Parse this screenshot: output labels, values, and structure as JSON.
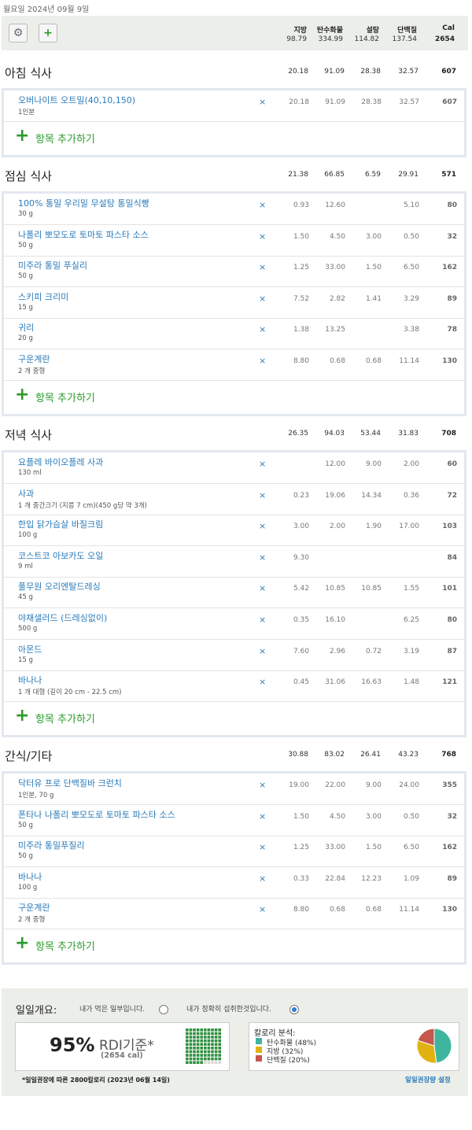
{
  "date": "월요일 2024년 09월 9일",
  "columns": [
    "지방",
    "탄수화물",
    "설탕",
    "단백질",
    "Cal"
  ],
  "totals": [
    "98.79",
    "334.99",
    "114.82",
    "137.54",
    "2654"
  ],
  "add_label": "항목 추가하기",
  "meals": [
    {
      "title": "아침 식사",
      "totals": [
        "20.18",
        "91.09",
        "28.38",
        "32.57",
        "607"
      ],
      "items": [
        {
          "name": "오버나이트 오트밀(40,10,150)",
          "sub": "1인분",
          "vals": [
            "20.18",
            "91.09",
            "28.38",
            "32.57",
            "607"
          ]
        }
      ]
    },
    {
      "title": "점심 식사",
      "totals": [
        "21.38",
        "66.85",
        "6.59",
        "29.91",
        "571"
      ],
      "items": [
        {
          "name": "100% 통밀 우리밀 무설탕 통밀식빵",
          "sub": "30 g",
          "vals": [
            "0.93",
            "12.60",
            "",
            "5.10",
            "80"
          ]
        },
        {
          "name": "나폴리 뽀모도로 토마토 파스타 소스",
          "sub": "50 g",
          "vals": [
            "1.50",
            "4.50",
            "3.00",
            "0.50",
            "32"
          ]
        },
        {
          "name": "미주라 통밀 푸실리",
          "sub": "50 g",
          "vals": [
            "1.25",
            "33.00",
            "1.50",
            "6.50",
            "162"
          ]
        },
        {
          "name": "스키피 크리미",
          "sub": "15 g",
          "vals": [
            "7.52",
            "2.82",
            "1.41",
            "3.29",
            "89"
          ]
        },
        {
          "name": "귀리",
          "sub": "20 g",
          "vals": [
            "1.38",
            "13.25",
            "",
            "3.38",
            "78"
          ]
        },
        {
          "name": "구운계란",
          "sub": "2 개 중형",
          "vals": [
            "8.80",
            "0.68",
            "0.68",
            "11.14",
            "130"
          ]
        }
      ]
    },
    {
      "title": "저녁 식사",
      "totals": [
        "26.35",
        "94.03",
        "53.44",
        "31.83",
        "708"
      ],
      "items": [
        {
          "name": "요플레 바이오플레 사과",
          "sub": "130 ml",
          "vals": [
            "",
            "12.00",
            "9.00",
            "2.00",
            "60"
          ]
        },
        {
          "name": "사과",
          "sub": "1 개 중간크기 (지름 7 cm)(450 g당 약 3개)",
          "vals": [
            "0.23",
            "19.06",
            "14.34",
            "0.36",
            "72"
          ]
        },
        {
          "name": "한입 닭가슴살 바질크림",
          "sub": "100 g",
          "vals": [
            "3.00",
            "2.00",
            "1.90",
            "17.00",
            "103"
          ]
        },
        {
          "name": "코스트코 아보카도 오일",
          "sub": "9 ml",
          "vals": [
            "9.30",
            "",
            "",
            "",
            "84"
          ]
        },
        {
          "name": "풀무원 오리엔탈드레싱",
          "sub": "45 g",
          "vals": [
            "5.42",
            "10.85",
            "10.85",
            "1.55",
            "101"
          ]
        },
        {
          "name": "야채샐러드 (드레싱없이)",
          "sub": "500 g",
          "vals": [
            "0.35",
            "16.10",
            "",
            "6.25",
            "80"
          ]
        },
        {
          "name": "아몬드",
          "sub": "15 g",
          "vals": [
            "7.60",
            "2.96",
            "0.72",
            "3.19",
            "87"
          ]
        },
        {
          "name": "바나나",
          "sub": "1 개 대형 (길이 20 cm - 22.5 cm)",
          "vals": [
            "0.45",
            "31.06",
            "16.63",
            "1.48",
            "121"
          ]
        }
      ]
    },
    {
      "title": "간식/기타",
      "totals": [
        "30.88",
        "83.02",
        "26.41",
        "43.23",
        "768"
      ],
      "items": [
        {
          "name": "닥터유 프로 단백질바 크런치",
          "sub": "1인분, 70 g",
          "vals": [
            "19.00",
            "22.00",
            "9.00",
            "24.00",
            "355"
          ]
        },
        {
          "name": "폰타나 나폴리 뽀모도로 토마토 파스타 소스",
          "sub": "50 g",
          "vals": [
            "1.50",
            "4.50",
            "3.00",
            "0.50",
            "32"
          ]
        },
        {
          "name": "미주라 통밀푸질리",
          "sub": "50 g",
          "vals": [
            "1.25",
            "33.00",
            "1.50",
            "6.50",
            "162"
          ]
        },
        {
          "name": "바나나",
          "sub": "100 g",
          "vals": [
            "0.33",
            "22.84",
            "12.23",
            "1.09",
            "89"
          ]
        },
        {
          "name": "구운계란",
          "sub": "2 개 중형",
          "vals": [
            "8.80",
            "0.68",
            "0.68",
            "11.14",
            "130"
          ]
        }
      ]
    }
  ],
  "summary": {
    "title": "일일개요:",
    "option_partial": "내가 먹은 일부입니다.",
    "option_exact": "내가 정확히 섭취한것입니다.",
    "selected_option": "exact",
    "percent": "95%",
    "rdi_label": "RDI기준*",
    "cal_text": "(2654 cal)",
    "rdi_fraction": 0.95,
    "breakdown_title": "칼로리 분석:",
    "breakdown": [
      {
        "label": "탄수화물 (48%)",
        "pct": 48,
        "color": "#3fb59e"
      },
      {
        "label": "지방 (32%)",
        "pct": 32,
        "color": "#e2b214"
      },
      {
        "label": "단백질 (20%)",
        "pct": 20,
        "color": "#c7574d"
      }
    ],
    "footnote": "*일일권장에 따른 2800칼로리 (2023년 06월 14일)",
    "link": "일일권장량 설정"
  },
  "icons": {
    "settings": "gear-icon",
    "add_meal": "add-meal-icon",
    "delete": "close-icon",
    "add": "plus-icon"
  }
}
